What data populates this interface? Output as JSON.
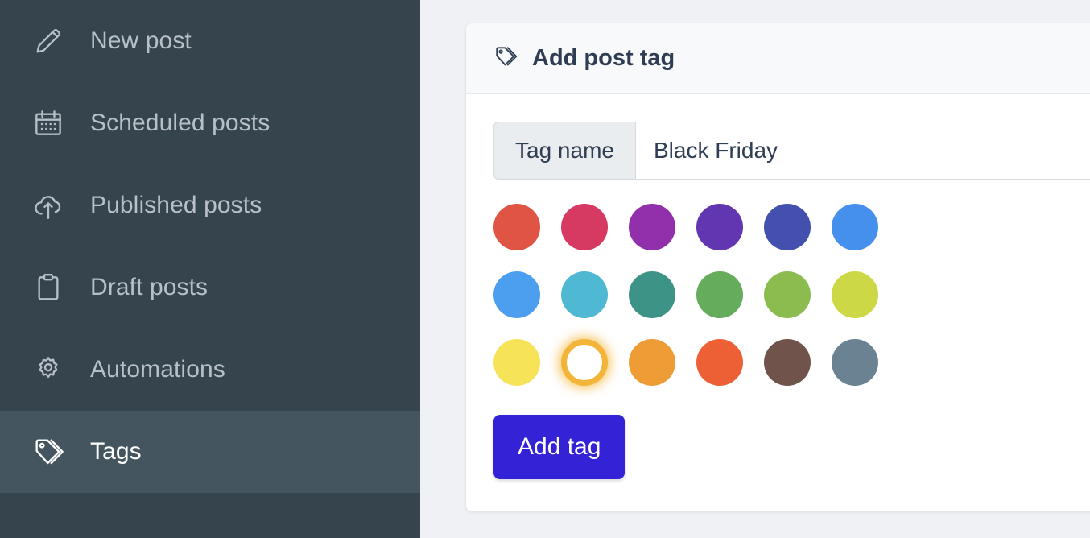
{
  "sidebar": {
    "items": [
      {
        "label": "New post",
        "icon": "pencil-icon",
        "active": false
      },
      {
        "label": "Scheduled posts",
        "icon": "calendar-icon",
        "active": false
      },
      {
        "label": "Published posts",
        "icon": "cloud-upload-icon",
        "active": false
      },
      {
        "label": "Draft posts",
        "icon": "clipboard-icon",
        "active": false
      },
      {
        "label": "Automations",
        "icon": "gear-icon",
        "active": false
      },
      {
        "label": "Tags",
        "icon": "tag-icon",
        "active": true
      }
    ],
    "background_color": "#36444d",
    "active_background_color": "#455560"
  },
  "card": {
    "header": {
      "title": "Add post tag",
      "icon": "tag-icon"
    },
    "tag_name_field": {
      "label": "Tag name",
      "value": "Black Friday",
      "placeholder": "Tag name"
    },
    "color_picker": {
      "selected_index": 13,
      "selected_ring_color": "#f2b53a",
      "rows": [
        [
          {
            "name": "red",
            "hex": "#e05443"
          },
          {
            "name": "pink",
            "hex": "#d63a63"
          },
          {
            "name": "magenta",
            "hex": "#9230ac"
          },
          {
            "name": "purple",
            "hex": "#6236b0"
          },
          {
            "name": "indigo",
            "hex": "#4350ae"
          },
          {
            "name": "blue",
            "hex": "#4590ec"
          }
        ],
        [
          {
            "name": "light-blue",
            "hex": "#4b9fee"
          },
          {
            "name": "cyan",
            "hex": "#4fb8d3"
          },
          {
            "name": "teal",
            "hex": "#3d9386"
          },
          {
            "name": "green",
            "hex": "#65ac5d"
          },
          {
            "name": "light-green",
            "hex": "#8cbc50"
          },
          {
            "name": "lime",
            "hex": "#ccd846"
          }
        ],
        [
          {
            "name": "yellow",
            "hex": "#f7e358"
          },
          {
            "name": "white",
            "hex": "#ffffff"
          },
          {
            "name": "orange",
            "hex": "#ee9c36"
          },
          {
            "name": "deep-orange",
            "hex": "#ed6036"
          },
          {
            "name": "brown",
            "hex": "#70544b"
          },
          {
            "name": "blue-grey",
            "hex": "#6b8292"
          }
        ]
      ]
    },
    "submit_button": {
      "label": "Add tag",
      "color": "#3322d6"
    }
  }
}
